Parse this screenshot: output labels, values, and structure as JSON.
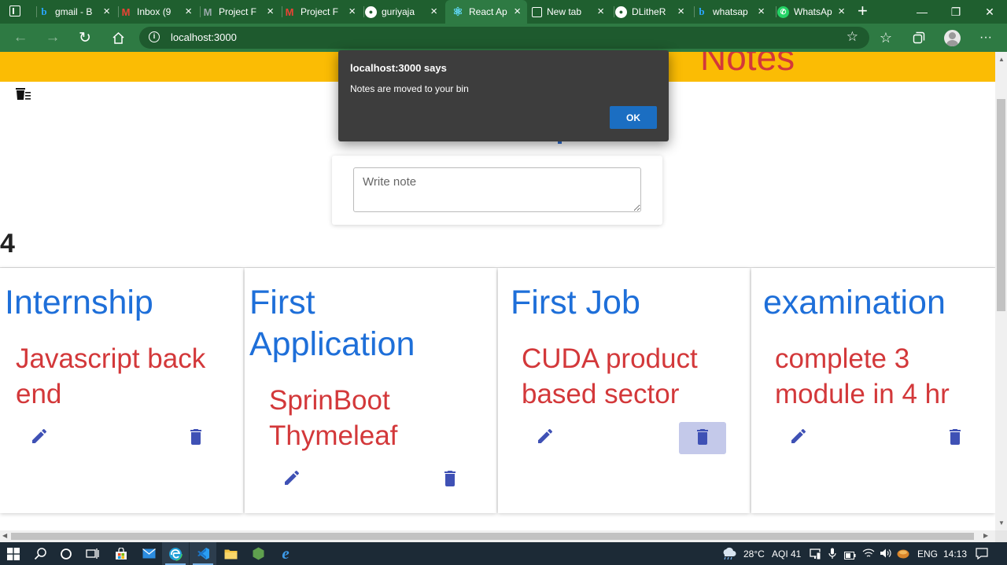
{
  "browser": {
    "tabs": [
      {
        "title": "gmail - B",
        "favicon": "bing-icon",
        "active": false
      },
      {
        "title": "Inbox (9",
        "favicon": "gmail-icon",
        "active": false
      },
      {
        "title": "Project F",
        "favicon": "gmail-icon",
        "active": false
      },
      {
        "title": "Project F",
        "favicon": "gmail-icon",
        "active": false
      },
      {
        "title": "guriyaja",
        "favicon": "github-icon",
        "active": false
      },
      {
        "title": "React Ap",
        "favicon": "react-icon",
        "active": true
      },
      {
        "title": "New tab",
        "favicon": "new-tab-icon",
        "active": false
      },
      {
        "title": "DLitheR",
        "favicon": "github-icon",
        "active": false
      },
      {
        "title": "whatsap",
        "favicon": "bing-icon",
        "active": false
      },
      {
        "title": "WhatsAp",
        "favicon": "whatsapp-icon",
        "active": false
      }
    ],
    "new_tab_symbol": "+",
    "url": "localhost:3000",
    "window_controls": {
      "minimize": "—",
      "maximize": "❐",
      "close": "✕"
    },
    "theme_color": "#2e7a43"
  },
  "page": {
    "header_title": "Notes",
    "header_color": "#fbbc04",
    "note_form": {
      "placeholder": "Write note"
    },
    "note_count": "4",
    "notes": [
      {
        "title": "Internship",
        "content": "Javascript back end",
        "delete_hover": false
      },
      {
        "title": "First Application",
        "content": "SprinBoot Thymeleaf",
        "delete_hover": false
      },
      {
        "title": "First Job",
        "content": "CUDA product based sector",
        "delete_hover": true
      },
      {
        "title": "examination",
        "content": "complete 3 module in 4 hr",
        "delete_hover": false
      }
    ],
    "colors": {
      "title": "#1e6fd9",
      "content": "#d3383a",
      "icons": "#3f51b5"
    }
  },
  "dialog": {
    "title": "localhost:3000 says",
    "message": "Notes are moved to your bin",
    "ok_label": "OK"
  },
  "taskbar": {
    "weather": "28°C",
    "aqi": "AQI 41",
    "language": "ENG",
    "time": "14:13"
  }
}
